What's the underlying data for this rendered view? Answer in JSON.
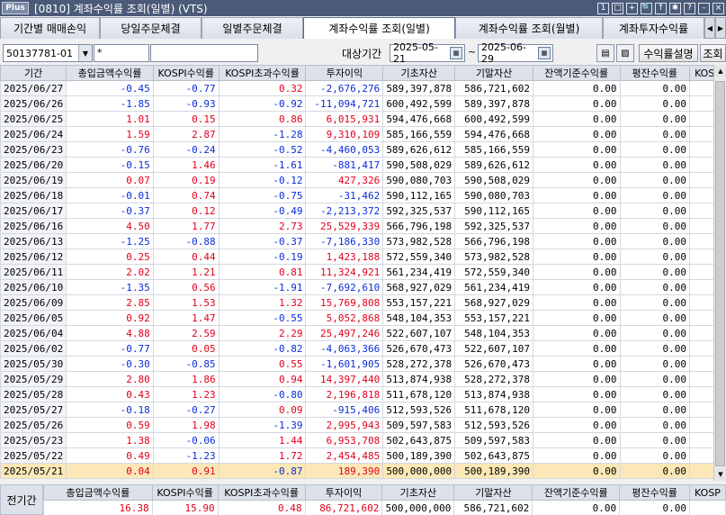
{
  "window": {
    "logo": "Plus",
    "title": "[0810] 계좌수익률 조회(일별) (VTS)",
    "icons": [
      "1",
      "□",
      "+",
      "🔍",
      "↑",
      "✱",
      "?",
      "–",
      "×"
    ]
  },
  "tabs": [
    {
      "label": "기간별 매매손익",
      "active": false
    },
    {
      "label": "당일주문체결",
      "active": false
    },
    {
      "label": "일별주문체결",
      "active": false
    },
    {
      "label": "계좌수익률 조회(일별)",
      "active": true
    },
    {
      "label": "계좌수익률 조회(월별)",
      "active": false
    },
    {
      "label": "계좌투자수익률",
      "active": false
    }
  ],
  "toolbar": {
    "account": "50137781-01",
    "password": "*",
    "period_label": "대상기간",
    "date_from": "2025-05-21",
    "date_to": "2025-06-29",
    "tilde": "~",
    "explain_button": "수익률설명",
    "search_button": "조회"
  },
  "columns": [
    "기간",
    "총입금액수익률",
    "KOSPI수익률",
    "KOSPI초과수익률",
    "투자이익",
    "기초자산",
    "기말자산",
    "잔액기준수익률",
    "평잔수익률",
    "KOSP"
  ],
  "rows": [
    [
      "2025/06/27",
      "-0.45",
      "-0.77",
      "0.32",
      "-2,676,276",
      "589,397,878",
      "586,721,602",
      "0.00",
      "0.00"
    ],
    [
      "2025/06/26",
      "-1.85",
      "-0.93",
      "-0.92",
      "-11,094,721",
      "600,492,599",
      "589,397,878",
      "0.00",
      "0.00"
    ],
    [
      "2025/06/25",
      "1.01",
      "0.15",
      "0.86",
      "6,015,931",
      "594,476,668",
      "600,492,599",
      "0.00",
      "0.00"
    ],
    [
      "2025/06/24",
      "1.59",
      "2.87",
      "-1.28",
      "9,310,109",
      "585,166,559",
      "594,476,668",
      "0.00",
      "0.00"
    ],
    [
      "2025/06/23",
      "-0.76",
      "-0.24",
      "-0.52",
      "-4,460,053",
      "589,626,612",
      "585,166,559",
      "0.00",
      "0.00"
    ],
    [
      "2025/06/20",
      "-0.15",
      "1.46",
      "-1.61",
      "-881,417",
      "590,508,029",
      "589,626,612",
      "0.00",
      "0.00"
    ],
    [
      "2025/06/19",
      "0.07",
      "0.19",
      "-0.12",
      "427,326",
      "590,080,703",
      "590,508,029",
      "0.00",
      "0.00"
    ],
    [
      "2025/06/18",
      "-0.01",
      "0.74",
      "-0.75",
      "-31,462",
      "590,112,165",
      "590,080,703",
      "0.00",
      "0.00"
    ],
    [
      "2025/06/17",
      "-0.37",
      "0.12",
      "-0.49",
      "-2,213,372",
      "592,325,537",
      "590,112,165",
      "0.00",
      "0.00"
    ],
    [
      "2025/06/16",
      "4.50",
      "1.77",
      "2.73",
      "25,529,339",
      "566,796,198",
      "592,325,537",
      "0.00",
      "0.00"
    ],
    [
      "2025/06/13",
      "-1.25",
      "-0.88",
      "-0.37",
      "-7,186,330",
      "573,982,528",
      "566,796,198",
      "0.00",
      "0.00"
    ],
    [
      "2025/06/12",
      "0.25",
      "0.44",
      "-0.19",
      "1,423,188",
      "572,559,340",
      "573,982,528",
      "0.00",
      "0.00"
    ],
    [
      "2025/06/11",
      "2.02",
      "1.21",
      "0.81",
      "11,324,921",
      "561,234,419",
      "572,559,340",
      "0.00",
      "0.00"
    ],
    [
      "2025/06/10",
      "-1.35",
      "0.56",
      "-1.91",
      "-7,692,610",
      "568,927,029",
      "561,234,419",
      "0.00",
      "0.00"
    ],
    [
      "2025/06/09",
      "2.85",
      "1.53",
      "1.32",
      "15,769,808",
      "553,157,221",
      "568,927,029",
      "0.00",
      "0.00"
    ],
    [
      "2025/06/05",
      "0.92",
      "1.47",
      "-0.55",
      "5,052,868",
      "548,104,353",
      "553,157,221",
      "0.00",
      "0.00"
    ],
    [
      "2025/06/04",
      "4.88",
      "2.59",
      "2.29",
      "25,497,246",
      "522,607,107",
      "548,104,353",
      "0.00",
      "0.00"
    ],
    [
      "2025/06/02",
      "-0.77",
      "0.05",
      "-0.82",
      "-4,063,366",
      "526,670,473",
      "522,607,107",
      "0.00",
      "0.00"
    ],
    [
      "2025/05/30",
      "-0.30",
      "-0.85",
      "0.55",
      "-1,601,905",
      "528,272,378",
      "526,670,473",
      "0.00",
      "0.00"
    ],
    [
      "2025/05/29",
      "2.80",
      "1.86",
      "0.94",
      "14,397,440",
      "513,874,938",
      "528,272,378",
      "0.00",
      "0.00"
    ],
    [
      "2025/05/28",
      "0.43",
      "1.23",
      "-0.80",
      "2,196,818",
      "511,678,120",
      "513,874,938",
      "0.00",
      "0.00"
    ],
    [
      "2025/05/27",
      "-0.18",
      "-0.27",
      "0.09",
      "-915,406",
      "512,593,526",
      "511,678,120",
      "0.00",
      "0.00"
    ],
    [
      "2025/05/26",
      "0.59",
      "1.98",
      "-1.39",
      "2,995,943",
      "509,597,583",
      "512,593,526",
      "0.00",
      "0.00"
    ],
    [
      "2025/05/23",
      "1.38",
      "-0.06",
      "1.44",
      "6,953,708",
      "502,643,875",
      "509,597,583",
      "0.00",
      "0.00"
    ],
    [
      "2025/05/22",
      "0.49",
      "-1.23",
      "1.72",
      "2,454,485",
      "500,189,390",
      "502,643,875",
      "0.00",
      "0.00"
    ],
    [
      "2025/05/21",
      "0.04",
      "0.91",
      "-0.87",
      "189,390",
      "500,000,000",
      "500,189,390",
      "0.00",
      "0.00"
    ]
  ],
  "highlight_row": 25,
  "summary": {
    "label": "전기간",
    "columns": [
      "총입금액수익률",
      "KOSPI수익률",
      "KOSPI초과수익률",
      "투자이익",
      "기초자산",
      "기말자산",
      "잔액기준수익률",
      "평잔수익률",
      "KOSP"
    ],
    "values": [
      "16.38",
      "15.90",
      "0.48",
      "86,721,602",
      "500,000,000",
      "586,721,602",
      "0.00",
      "0.00"
    ]
  },
  "colors": {
    "positive": "#e0001b",
    "negative": "#0a2cd8",
    "highlight": "#fbe8b6",
    "title_bar": "#4a5a78"
  }
}
